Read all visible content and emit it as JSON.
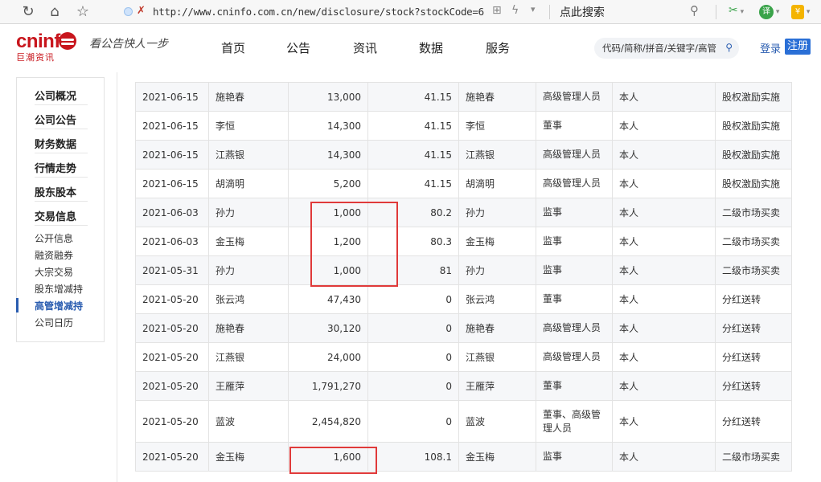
{
  "browser": {
    "url": "http://www.cninfo.com.cn/new/disclosure/stock?stockCode=6",
    "search_placeholder": "点此搜索"
  },
  "site": {
    "logo_text": "cninf",
    "logo_sub": "巨潮资讯",
    "slogan": "看公告快人一步",
    "nav": [
      "首页",
      "公告",
      "资讯",
      "数据",
      "服务"
    ],
    "search_placeholder": "代码/简称/拼音/关键字/高管",
    "login": "登录",
    "register": "注册"
  },
  "sidebar": {
    "major": [
      "公司概况",
      "公司公告",
      "财务数据",
      "行情走势",
      "股东股本",
      "交易信息"
    ],
    "minor": [
      "公开信息",
      "融资融券",
      "大宗交易",
      "股东增减持",
      "高管增减持",
      "公司日历"
    ],
    "active": "高管增减持"
  },
  "table": {
    "rows": [
      {
        "date": "2021-06-15",
        "name": "施艳春",
        "shares": "13,000",
        "price": "41.15",
        "holder": "施艳春",
        "position": "高级管理人员",
        "relation": "本人",
        "reason": "股权激励实施"
      },
      {
        "date": "2021-06-15",
        "name": "李恒",
        "shares": "14,300",
        "price": "41.15",
        "holder": "李恒",
        "position": "董事",
        "relation": "本人",
        "reason": "股权激励实施"
      },
      {
        "date": "2021-06-15",
        "name": "江燕银",
        "shares": "14,300",
        "price": "41.15",
        "holder": "江燕银",
        "position": "高级管理人员",
        "relation": "本人",
        "reason": "股权激励实施"
      },
      {
        "date": "2021-06-15",
        "name": "胡滴明",
        "shares": "5,200",
        "price": "41.15",
        "holder": "胡滴明",
        "position": "高级管理人员",
        "relation": "本人",
        "reason": "股权激励实施"
      },
      {
        "date": "2021-06-03",
        "name": "孙力",
        "shares": "1,000",
        "price": "80.2",
        "holder": "孙力",
        "position": "监事",
        "relation": "本人",
        "reason": "二级市场买卖"
      },
      {
        "date": "2021-06-03",
        "name": "金玉梅",
        "shares": "1,200",
        "price": "80.3",
        "holder": "金玉梅",
        "position": "监事",
        "relation": "本人",
        "reason": "二级市场买卖"
      },
      {
        "date": "2021-05-31",
        "name": "孙力",
        "shares": "1,000",
        "price": "81",
        "holder": "孙力",
        "position": "监事",
        "relation": "本人",
        "reason": "二级市场买卖"
      },
      {
        "date": "2021-05-20",
        "name": "张云鸿",
        "shares": "47,430",
        "price": "0",
        "holder": "张云鸿",
        "position": "董事",
        "relation": "本人",
        "reason": "分红送转"
      },
      {
        "date": "2021-05-20",
        "name": "施艳春",
        "shares": "30,120",
        "price": "0",
        "holder": "施艳春",
        "position": "高级管理人员",
        "relation": "本人",
        "reason": "分红送转"
      },
      {
        "date": "2021-05-20",
        "name": "江燕银",
        "shares": "24,000",
        "price": "0",
        "holder": "江燕银",
        "position": "高级管理人员",
        "relation": "本人",
        "reason": "分红送转"
      },
      {
        "date": "2021-05-20",
        "name": "王雁萍",
        "shares": "1,791,270",
        "price": "0",
        "holder": "王雁萍",
        "position": "董事",
        "relation": "本人",
        "reason": "分红送转"
      },
      {
        "date": "2021-05-20",
        "name": "蓝波",
        "shares": "2,454,820",
        "price": "0",
        "holder": "蓝波",
        "position": "董事、高级管理人员",
        "relation": "本人",
        "reason": "分红送转"
      },
      {
        "date": "2021-05-20",
        "name": "金玉梅",
        "shares": "1,600",
        "price": "108.1",
        "holder": "金玉梅",
        "position": "监事",
        "relation": "本人",
        "reason": "二级市场买卖"
      }
    ]
  },
  "highlight_color": "#e03a3a",
  "brand_color": "#c8161d"
}
